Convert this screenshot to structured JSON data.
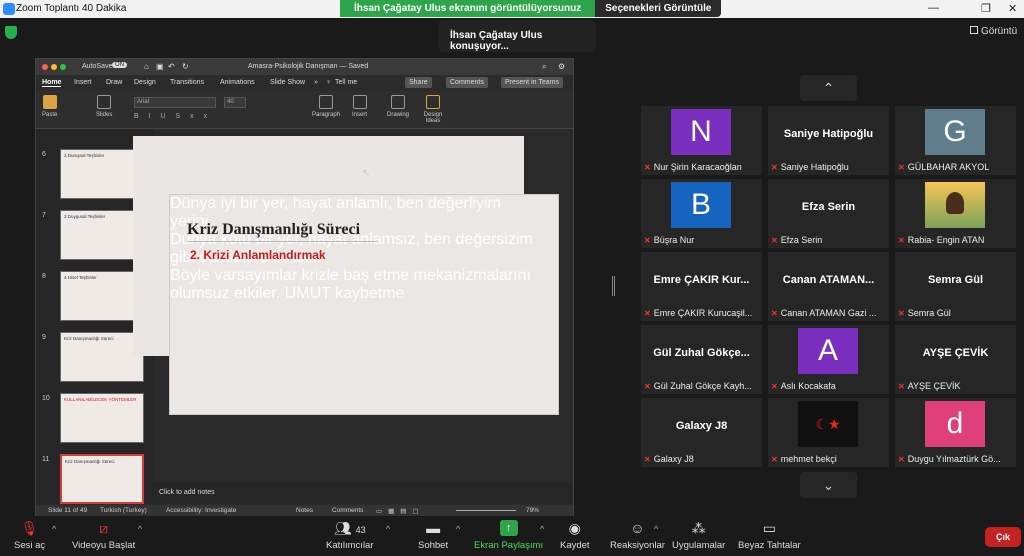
{
  "window": {
    "title": "Zoom Toplantı 40 Dakika"
  },
  "share": {
    "banner": "İhsan Çağatay Ulus ekranını görüntülüyorsunuz",
    "options": "Seçenekleri Görüntüle"
  },
  "speaking": "İhsan Çağatay Ulus konuşuyor...",
  "view_label": "Görüntü",
  "ppt": {
    "autosave": "AutoSave",
    "toggle": "ON",
    "title": "Amasra-Psikolojik Danışman — Saved",
    "tabs": [
      "Home",
      "Insert",
      "Draw",
      "Design",
      "Transitions",
      "Animations",
      "Slide Show",
      "Tell me"
    ],
    "share": "Share",
    "comments": "Comments",
    "present": "Present in Teams",
    "ribbon": {
      "paste": "Paste",
      "slides": "Slides",
      "font": "Arial",
      "size": "40",
      "paragraph": "Paragraph",
      "insert": "Insert",
      "drawing": "Drawing",
      "design_ideas": "Design Ideas"
    },
    "thumbs": [
      {
        "num": "6",
        "title": "2.Duruşsal Teşhisler"
      },
      {
        "num": "7",
        "title": "3.Duygusal Teşhisler"
      },
      {
        "num": "8",
        "title": "4.Hisel Teşhisler"
      },
      {
        "num": "9",
        "title": "Kriz Danışmanlığı Süreci"
      },
      {
        "num": "10",
        "title": "KULLANILABİLECEK YÖNTEMLER"
      },
      {
        "num": "11",
        "title": "Kriz Danışmanlığı Süreci"
      }
    ],
    "slide": {
      "title": "Kriz Danışmanlığı Süreci",
      "subtitle": "2. Krizi Anlamlandırmak",
      "l1": "Dünya iyi bir yer, hayat anlamlı, ben değerliyim",
      "l2": "yerini",
      "l3": "Dünya kötü bir yer, hayat anlamsız, ben değersizim",
      "l4": "gibi cümlelere bırakır.",
      "l5": "Böyle varsayımlar krizle baş etme mekanizmalarını",
      "l6": "olumsuz etkiler. UMUT kaybetme"
    },
    "notes": "Click to add notes",
    "status": {
      "slide": "Slide 11 of 49",
      "lang": "Turkish (Turkey)",
      "access": "Accessibility: Investigate",
      "notes": "Notes",
      "comments": "Comments",
      "zoom": "79%"
    }
  },
  "participants": [
    {
      "name": "Nur Şirin Karacaoğlan",
      "avatar": "N",
      "color": "#7b2fbe",
      "type": "avatar"
    },
    {
      "name": "Saniye Hatipoğlu",
      "big": "Saniye Hatipoğlu",
      "type": "name"
    },
    {
      "name": "GÜLBAHAR AKYOL",
      "avatar": "G",
      "color": "#607d8b",
      "type": "avatar"
    },
    {
      "name": "Büşra Nur",
      "avatar": "B",
      "color": "#1565c0",
      "type": "avatar"
    },
    {
      "name": "Efza Serin",
      "big": "Efza Serin",
      "type": "name"
    },
    {
      "name": "Rabia- Engin ATAN",
      "type": "photo"
    },
    {
      "name": "Emre ÇAKIR Kurucaşil...",
      "big": "Emre ÇAKIR Kur...",
      "type": "name"
    },
    {
      "name": "Canan ATAMAN Gazi ...",
      "big": "Canan ATAMAN...",
      "type": "name"
    },
    {
      "name": "Semra Gül",
      "big": "Semra Gül",
      "type": "name"
    },
    {
      "name": "Gül Zuhal Gökçe Kayh...",
      "big": "Gül Zuhal Gökçe...",
      "type": "name"
    },
    {
      "name": "Aslı Kocakafa",
      "avatar": "A",
      "color": "#7b2fbe",
      "type": "avatar"
    },
    {
      "name": "AYŞE ÇEVİK",
      "big": "AYŞE ÇEVİK",
      "type": "name"
    },
    {
      "name": "Galaxy J8",
      "big": "Galaxy J8",
      "type": "name"
    },
    {
      "name": "mehmet bekçi",
      "type": "flag"
    },
    {
      "name": "Duygu Yılmaztürk Gö...",
      "avatar": "d",
      "color": "#e0407a",
      "type": "avatar"
    }
  ],
  "toolbar": {
    "audio": "Sesi aç",
    "video": "Videoyu Başlat",
    "participants": "Katılımcılar",
    "count": "43",
    "chat": "Sohbet",
    "share": "Ekran Paylaşımı",
    "record": "Kaydet",
    "reactions": "Reaksiyonlar",
    "apps": "Uygulamalar",
    "whiteboard": "Beyaz Tahtalar",
    "end": "Çık"
  },
  "colors": {
    "share_green": "#2ea54a",
    "end_red": "#c52222",
    "accent_red": "#c41b1b"
  }
}
